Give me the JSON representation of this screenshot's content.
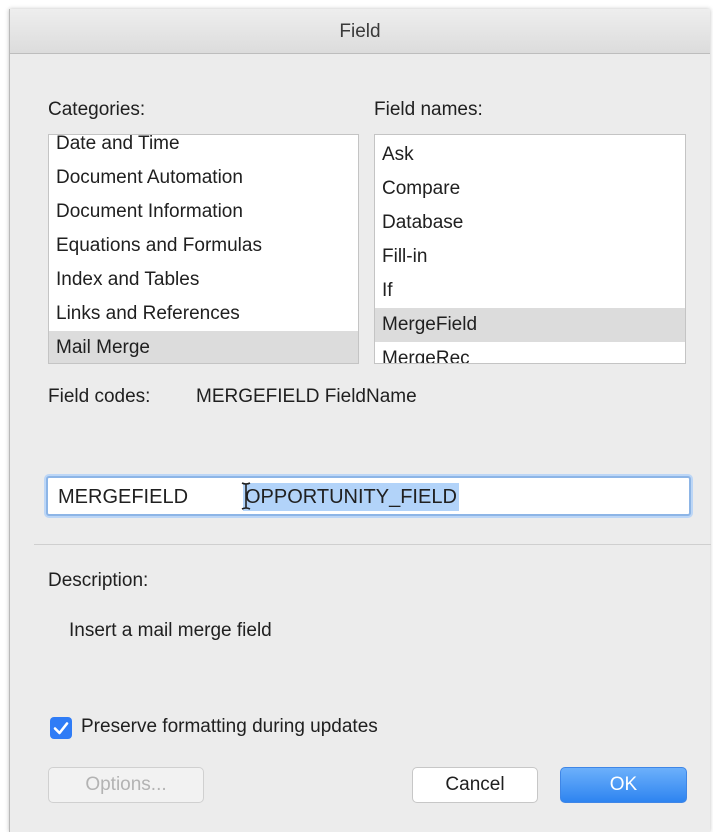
{
  "dialog": {
    "title": "Field"
  },
  "categories": {
    "label": "Categories:",
    "items": [
      "Date and Time",
      "Document Automation",
      "Document Information",
      "Equations and Formulas",
      "Index and Tables",
      "Links and References",
      "Mail Merge"
    ],
    "selected": "Mail Merge"
  },
  "field_names": {
    "label": "Field names:",
    "items": [
      "Ask",
      "Compare",
      "Database",
      "Fill-in",
      "If",
      "MergeField",
      "MergeRec"
    ],
    "selected": "MergeField"
  },
  "field_codes": {
    "label": "Field codes:",
    "syntax": "MERGEFIELD FieldName"
  },
  "field_input": {
    "prefix": "MERGEFIELD",
    "selected_text": "OPPORTUNITY_FIELD"
  },
  "description": {
    "label": "Description:",
    "text": "Insert a mail merge field"
  },
  "preserve_formatting": {
    "label": "Preserve formatting during updates",
    "checked": true
  },
  "buttons": {
    "options": "Options...",
    "cancel": "Cancel",
    "ok": "OK"
  },
  "colors": {
    "accent": "#2f7cf6",
    "selection": "#b2d3f9",
    "list_selected": "#dcdcdc"
  }
}
